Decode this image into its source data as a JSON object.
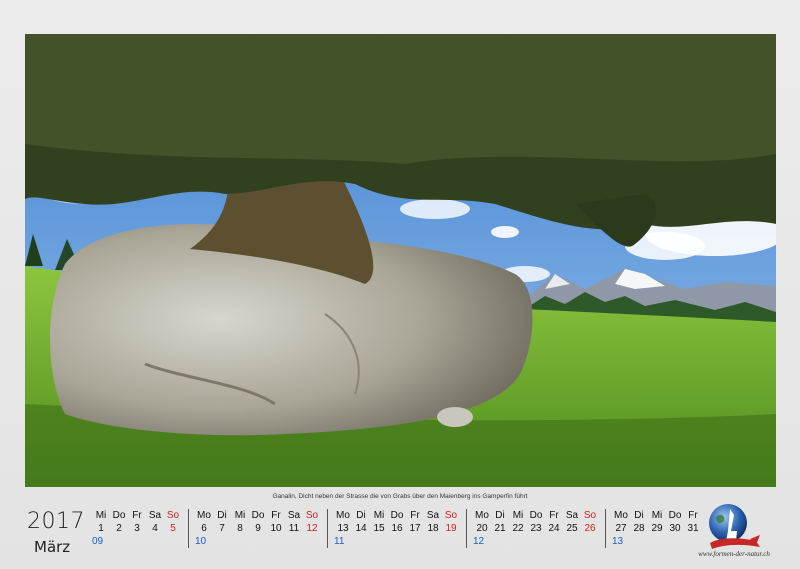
{
  "caption": "Ganalin, Dicht neben der Strasse die von Grabs über den Maienberg ins Gamperfin führt",
  "year": "2017",
  "month": "März",
  "logo_url": "www.formen-der-natur.ch",
  "weeks": [
    {
      "days": [
        "Mi",
        "Do",
        "Fr",
        "Sa",
        "So"
      ],
      "dates": [
        "1",
        "2",
        "3",
        "4",
        "5"
      ],
      "kw": "09"
    },
    {
      "days": [
        "Mo",
        "Di",
        "Mi",
        "Do",
        "Fr",
        "Sa",
        "So"
      ],
      "dates": [
        "6",
        "7",
        "8",
        "9",
        "10",
        "11",
        "12"
      ],
      "kw": "10"
    },
    {
      "days": [
        "Mo",
        "Di",
        "Mi",
        "Do",
        "Fr",
        "Sa",
        "So"
      ],
      "dates": [
        "13",
        "14",
        "15",
        "16",
        "17",
        "18",
        "19"
      ],
      "kw": "11"
    },
    {
      "days": [
        "Mo",
        "Di",
        "Mi",
        "Do",
        "Fr",
        "Sa",
        "So"
      ],
      "dates": [
        "20",
        "21",
        "22",
        "23",
        "24",
        "25",
        "26"
      ],
      "kw": "12"
    },
    {
      "days": [
        "Mo",
        "Di",
        "Mi",
        "Do",
        "Fr"
      ],
      "dates": [
        "27",
        "28",
        "29",
        "30",
        "31"
      ],
      "kw": "13"
    }
  ],
  "colors": {
    "sunday": "#d02020",
    "week_number": "#1a5fc8"
  }
}
